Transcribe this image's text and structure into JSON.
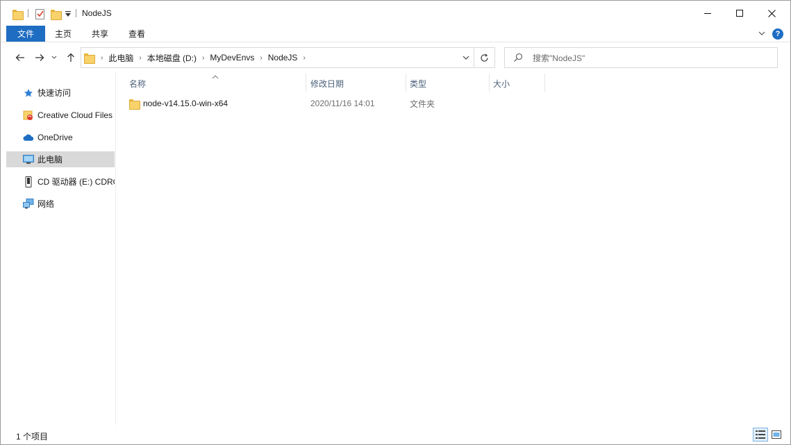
{
  "window": {
    "title": "NodeJS"
  },
  "ribbon": {
    "tabs": [
      {
        "label": "文件"
      },
      {
        "label": "主页"
      },
      {
        "label": "共享"
      },
      {
        "label": "查看"
      }
    ],
    "help_label": "?"
  },
  "address_bar": {
    "crumbs": [
      "此电脑",
      "本地磁盘 (D:)",
      "MyDevEnvs",
      "NodeJS"
    ],
    "separator": "›"
  },
  "search": {
    "placeholder": "搜索\"NodeJS\""
  },
  "sidebar": {
    "items": [
      {
        "label": "快速访问",
        "icon": "star-icon"
      },
      {
        "label": "Creative Cloud Files",
        "icon": "creative-cloud-icon"
      },
      {
        "label": "OneDrive",
        "icon": "cloud-icon"
      },
      {
        "label": "此电脑",
        "icon": "computer-icon",
        "selected": true
      },
      {
        "label": "CD 驱动器 (E:) CDROM",
        "icon": "cd-drive-icon"
      },
      {
        "label": "网络",
        "icon": "network-icon"
      }
    ]
  },
  "columns": {
    "name": "名称",
    "date": "修改日期",
    "type": "类型",
    "size": "大小"
  },
  "files": [
    {
      "name": "node-v14.15.0-win-x64",
      "date": "2020/11/16 14:01",
      "type": "文件夹",
      "size": ""
    }
  ],
  "status": {
    "item_count": "1 个项目"
  },
  "colors": {
    "accent": "#1e6dc2",
    "folder": "#f8d26a",
    "selected": "#d9d9d9"
  }
}
